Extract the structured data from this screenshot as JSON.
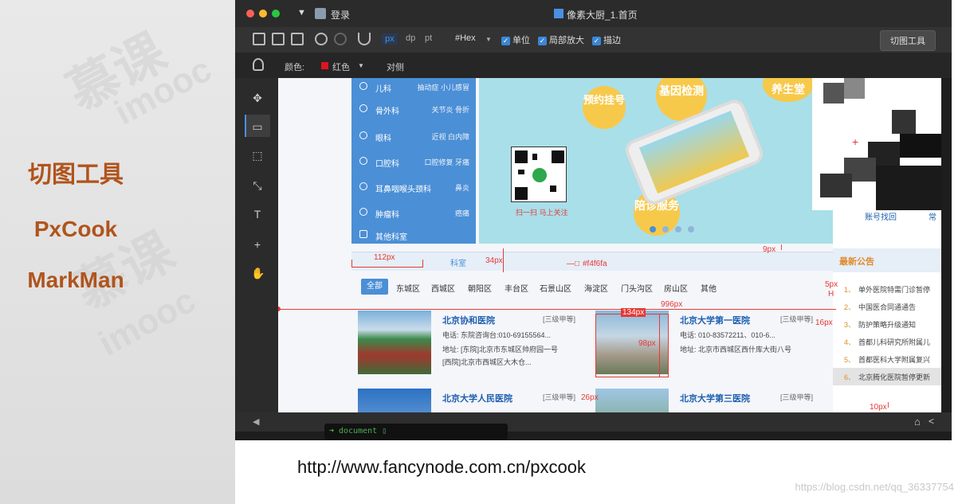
{
  "left_panel": {
    "titles": [
      "切图工具",
      "PxCook",
      "MarkMan"
    ],
    "watermark": [
      "慕课",
      "imooc",
      "慕课",
      "imooc"
    ]
  },
  "app": {
    "titlebar": {
      "login": "登录",
      "doc_title": "像素大厨_1.首页"
    },
    "toolbar": {
      "units": [
        "px",
        "dp",
        "pt"
      ],
      "color_format": "#Hex",
      "options": [
        "单位",
        "局部放大",
        "描边"
      ],
      "cut_button": "切图工具"
    },
    "colorbar": {
      "label": "颜色:",
      "color_name": "红色",
      "align": "对侧",
      "swatch": "#e0141e"
    },
    "console": "➜ document ▯"
  },
  "design": {
    "menu": [
      {
        "name": "儿科",
        "sub": "抽动症 小儿感冒"
      },
      {
        "name": "骨外科",
        "sub": "关节炎 骨折"
      },
      {
        "name": "眼科",
        "sub": "近视 白内障"
      },
      {
        "name": "口腔科",
        "sub": "口腔修复 牙痛"
      },
      {
        "name": "耳鼻咽喉头颈科",
        "sub": "鼻炎"
      },
      {
        "name": "肿瘤科",
        "sub": "癌痛"
      },
      {
        "name": "其他科室",
        "sub": ""
      }
    ],
    "banner": {
      "bubbles": [
        "预约挂号",
        "基因检测",
        "养生堂",
        "陪诊服务"
      ],
      "qr_caption": "扫一扫 马上关注"
    },
    "tab": "科室",
    "areas": [
      "全部",
      "东城区",
      "西城区",
      "朝阳区",
      "丰台区",
      "石景山区",
      "海淀区",
      "门头沟区",
      "房山区",
      "其他"
    ],
    "hospitals": [
      {
        "name": "北京协和医院",
        "level": "[三级甲等]",
        "lines": [
          "电话:  东院咨询台:010-69155564...",
          "地址:  [东院]北京市东城区帅府园一号",
          "[西院]北京市西城区大木仓..."
        ]
      },
      {
        "name": "北京大学第一医院",
        "level": "[三级甲等]",
        "lines": [
          "电话:  010-83572211、010-6...",
          "地址:  北京市西城区西什库大街八号"
        ]
      },
      {
        "name": "北京大学人民医院",
        "level": "[三级甲等]",
        "lines": []
      },
      {
        "name": "北京大学第三医院",
        "level": "[三级甲等]",
        "lines": []
      }
    ],
    "right": {
      "links": [
        "账号找回",
        "常"
      ],
      "notice_title": "最新公告",
      "notices": [
        "单外医院特需门诊暂停",
        "中国医合同通通告",
        "防护策略升级通知",
        "首都儿科研究所附属儿",
        "首都医科大学附属复兴",
        "北京腾化医院暂停更新"
      ]
    },
    "measurements": [
      "112px",
      "34px",
      "#f4f6fa",
      "9px",
      "5px",
      "996px",
      "134px",
      "98px",
      "16px",
      "26px",
      "10px"
    ]
  },
  "footer": {
    "url": "http://www.fancynode.com.cn/pxcook",
    "credit": "https://blog.csdn.net/qq_36337754"
  },
  "colors": {
    "accent": "#b0541c",
    "menu_blue": "#4b8fd6",
    "measure_red": "#e53935",
    "canvas_bg": "#f4f6fa"
  }
}
